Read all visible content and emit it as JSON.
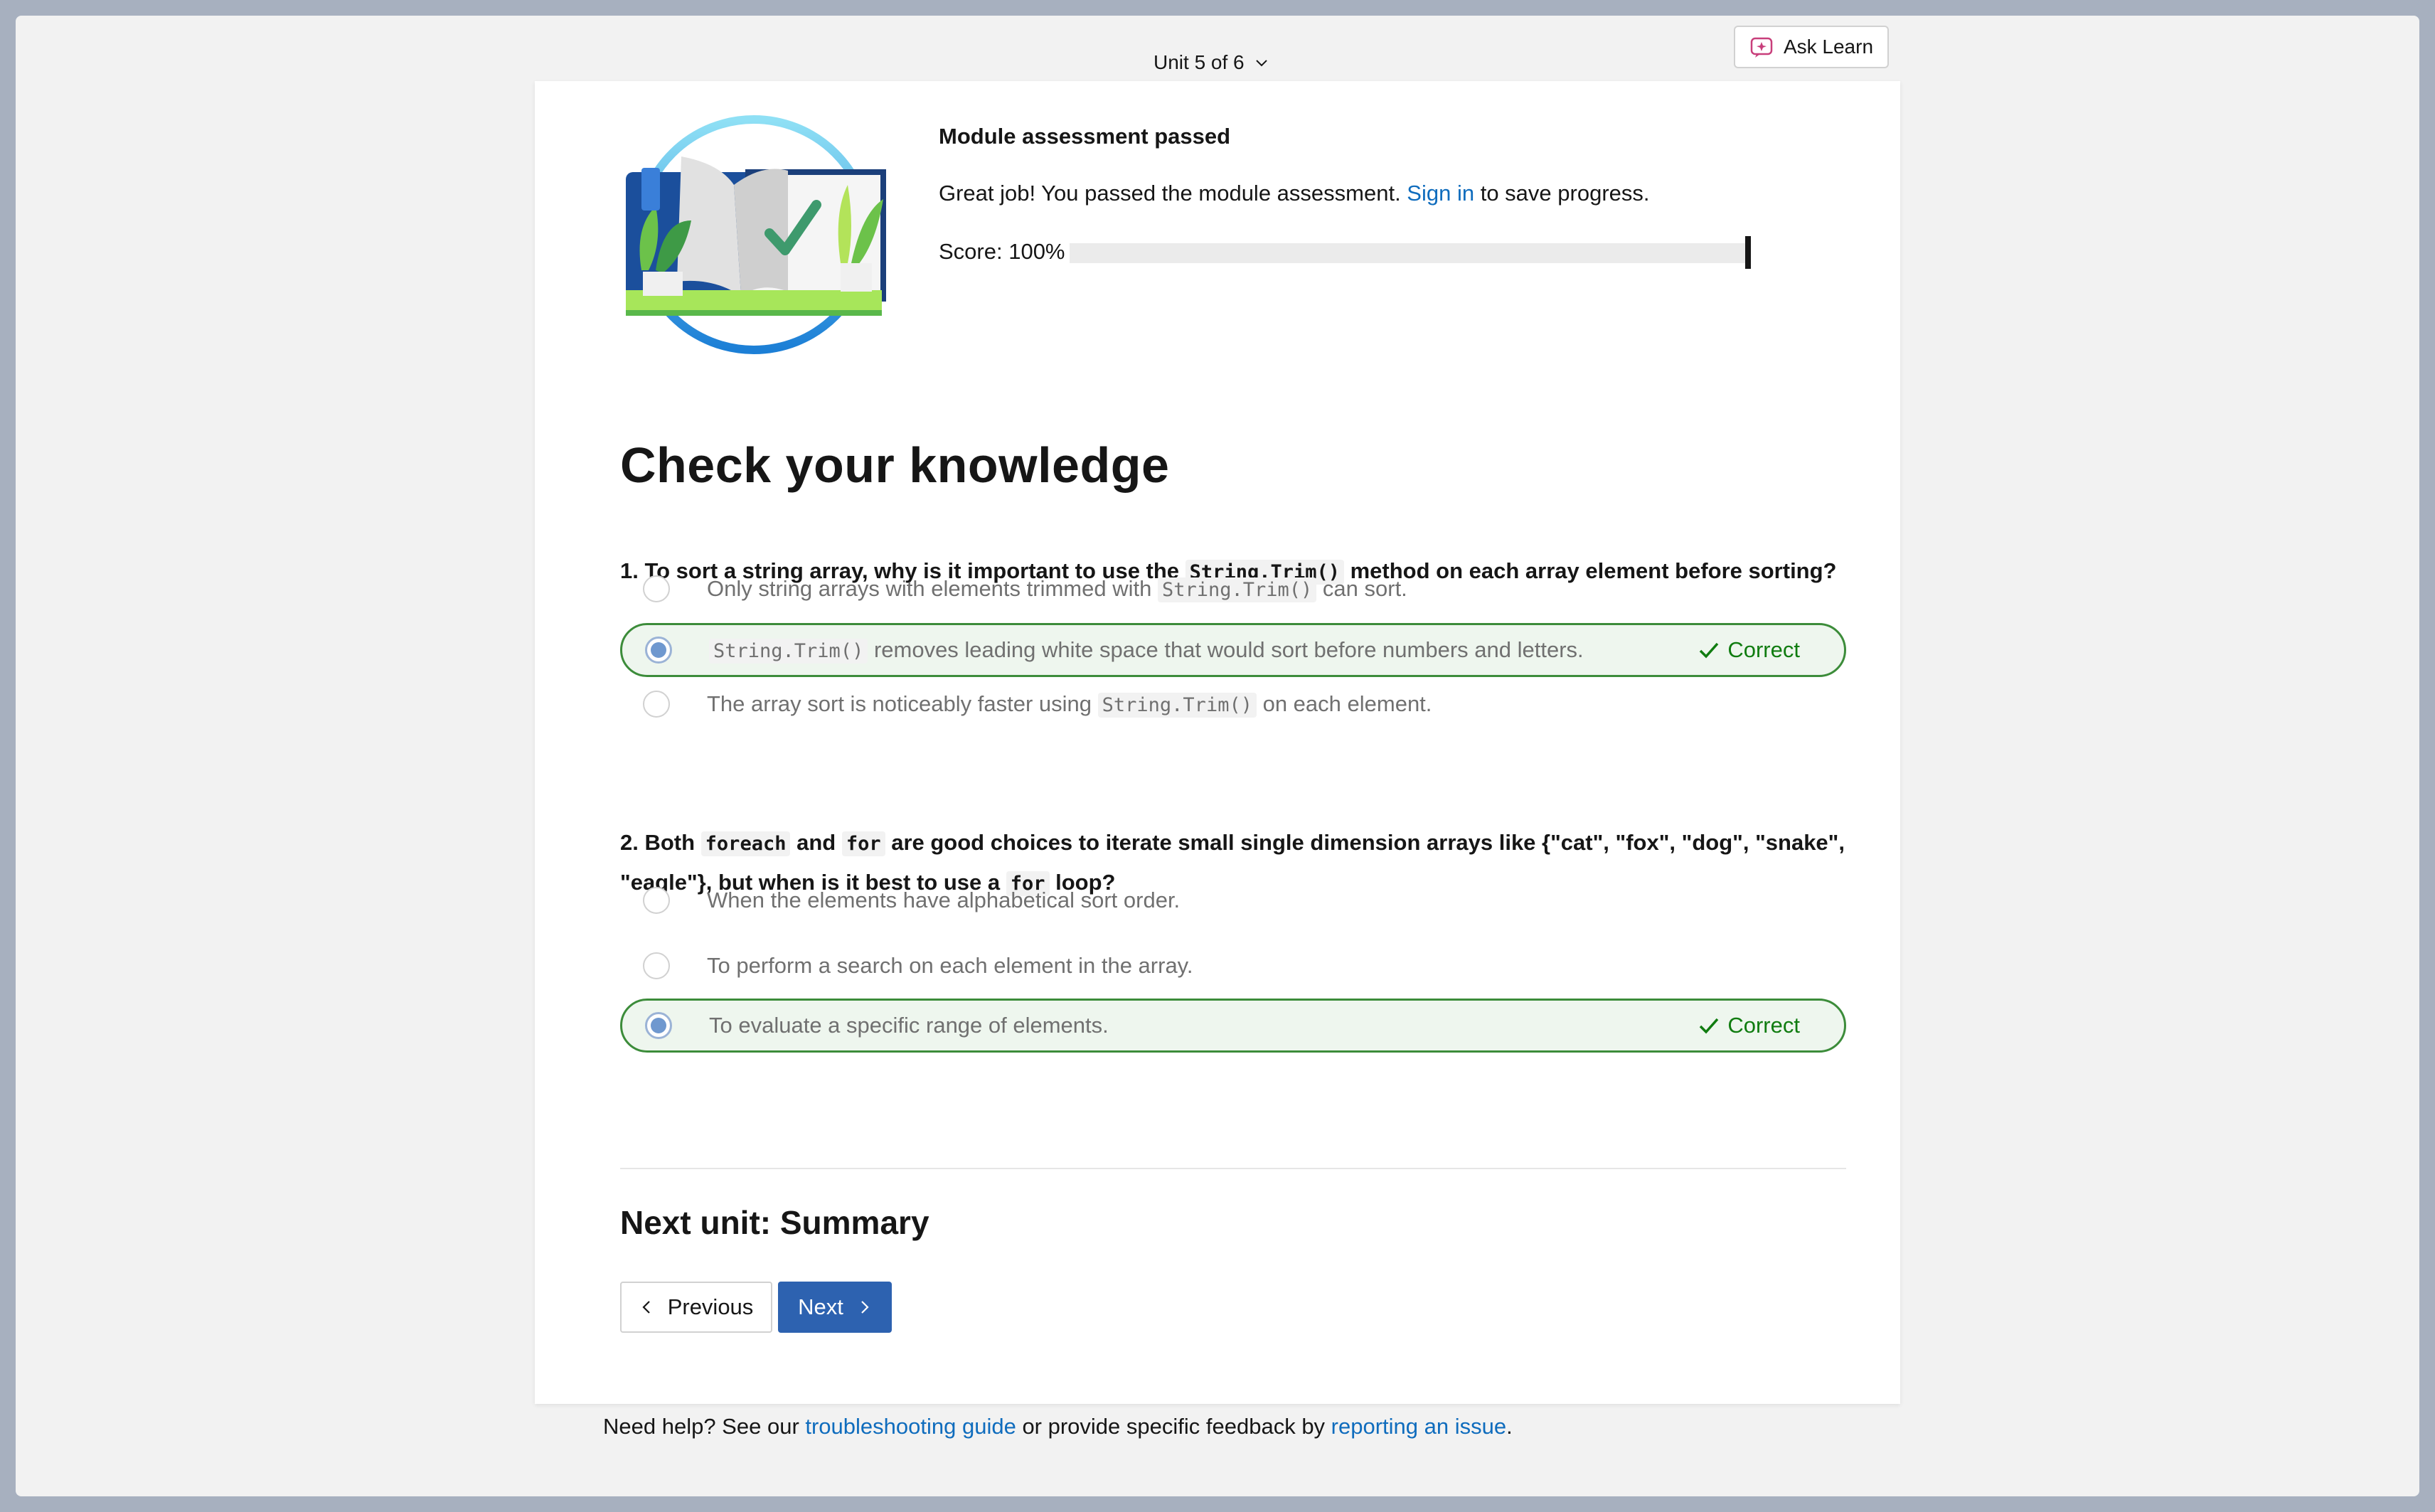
{
  "topbar": {
    "unit_label": "Unit 5 of 6",
    "ask_label": "Ask Learn"
  },
  "assessment": {
    "title": "Module assessment passed",
    "text_before": "Great job! You passed the module assessment. ",
    "signin": "Sign in",
    "text_after": " to save progress.",
    "score_label": "Score: 100%",
    "score_fraction": 1.0
  },
  "heading": "Check your knowledge",
  "q1": {
    "prefix": "1. To sort a string array, why is it important to use the ",
    "code": "String.Trim()",
    "suffix": " method on each array element before sorting?",
    "options": [
      {
        "before": "Only string arrays with elements trimmed with ",
        "code": "String.Trim()",
        "after": " can sort."
      },
      {
        "before": "",
        "code": "String.Trim()",
        "after": " removes leading white space that would sort before numbers and letters."
      },
      {
        "before": "The array sort is noticeably faster using ",
        "code": "String.Trim()",
        "after": " on each element."
      }
    ],
    "correct_label": "Correct"
  },
  "q2": {
    "p1": "2. Both ",
    "code1": "foreach",
    "p2": " and ",
    "code2": "for",
    "p3": " are good choices to iterate small single dimension arrays like {\"cat\", \"fox\", \"dog\", \"snake\",",
    "p4": "\"eagle\"}, but when is it best to use a ",
    "code3": "for",
    "p5": " loop?",
    "options": [
      "When the elements have alphabetical sort order.",
      "To perform a search on each element in the array.",
      "To evaluate a specific range of elements."
    ],
    "correct_label": "Correct"
  },
  "next_unit": "Next unit: Summary",
  "nav": {
    "previous": "Previous",
    "next": "Next"
  },
  "help": {
    "before": "Need help? See our ",
    "link1": "troubleshooting guide",
    "middle": " or provide specific feedback by ",
    "link2": "reporting an issue",
    "after": "."
  },
  "colors": {
    "accent": "#0f6cbd",
    "primary_button": "#2d62b0",
    "correct": "#107c10"
  }
}
